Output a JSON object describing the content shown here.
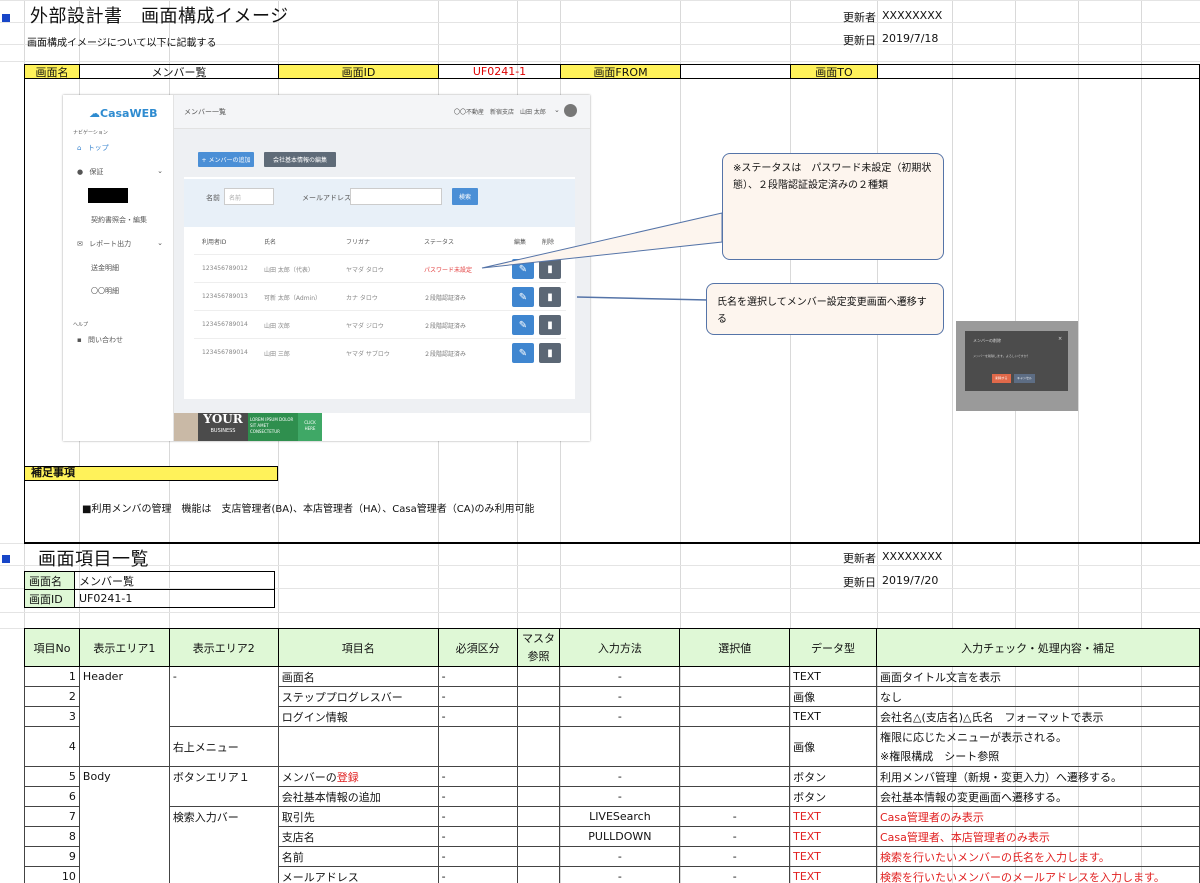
{
  "doc": {
    "title": "外部設計書　画面構成イメージ",
    "subtitle": "画面構成イメージについて以下に記載する",
    "updater_label": "更新者",
    "updater_value": "XXXXXXXX",
    "updated_label": "更新日",
    "updated_value": "2019/7/18"
  },
  "header_bar": {
    "screen_name_label": "画面名",
    "screen_name_value": "メンバー覧",
    "screen_id_label": "画面ID",
    "screen_id_value": "UF0241-1",
    "from_label": "画面FROM",
    "from_value": "",
    "to_label": "画面TO",
    "to_value": ""
  },
  "mock": {
    "logo": "CasaWEB",
    "nav_caption": "ナビゲーション",
    "nav_items": [
      "トップ",
      "保証",
      "",
      "契約書照会・編集",
      "レポート出力",
      "送金明細",
      "〇〇明細"
    ],
    "help_caption": "ヘルプ",
    "help_item": "問い合わせ",
    "page_title": "メンバー一覧",
    "user_info": "〇〇不動産　新宿支店　山田 太郎",
    "add_member_btn": "+ メンバーの追加",
    "edit_company_btn": "会社基本情報の編集",
    "name_label": "名前",
    "name_placeholder": "名前",
    "email_label": "メールアドレス",
    "search_btn": "検索",
    "columns": [
      "利用者ID",
      "氏名",
      "フリガナ",
      "ステータス",
      "編集",
      "削除"
    ],
    "rows": [
      {
        "id": "123456789012",
        "name": "山田 太郎（代表）",
        "kana": "ヤマダ タロウ",
        "status": "パスワード未設定",
        "status_color": "#e23b3b"
      },
      {
        "id": "123456789013",
        "name": "可新 太郎（Admin）",
        "kana": "カナ タロウ",
        "status": "２段階認証済み",
        "status_color": "#777777"
      },
      {
        "id": "123456789014",
        "name": "山田 次郎",
        "kana": "ヤマダ ジロウ",
        "status": "２段階認証済み",
        "status_color": "#777777"
      },
      {
        "id": "123456789014",
        "name": "山田 三郎",
        "kana": "ヤマダ サブロウ",
        "status": "２段階認証済み",
        "status_color": "#777777"
      }
    ],
    "banner_big": "YOUR",
    "banner_small": "BUSINESS",
    "banner_lorem": "LOREM IPSUM DOLOR SIT AMET CONSECTETUR",
    "banner_click": "CLICK HERE"
  },
  "callouts": {
    "status_note": "※ステータスは　パスワード未設定（初期状態）、２段階認証設定済みの２種類",
    "name_note": "氏名を選択してメンバー設定変更画面へ遷移する"
  },
  "popup": {
    "title": "メンバーの削除",
    "body": "メンバーを削除します。よろしいですか？",
    "delete_btn": "削除する",
    "cancel_btn": "キャンセル"
  },
  "supplement": {
    "label": "補足事項",
    "note": "■利用メンバの管理　機能は　支店管理者(BA)、本店管理者（HA）、Casa管理者（CA)のみ利用可能"
  },
  "item_list": {
    "title": "画面項目一覧",
    "updater_label": "更新者",
    "updater_value": "XXXXXXXX",
    "updated_label": "更新日",
    "updated_value": "2019/7/20",
    "screen_name_label": "画面名",
    "screen_name_value": "メンバー覧",
    "screen_id_label": "画面ID",
    "screen_id_value": "UF0241-1"
  },
  "table": {
    "headers": [
      "項目No",
      "表示エリア1",
      "表示エリア2",
      "項目名",
      "必須区分",
      "マスタ参照",
      "入力方法",
      "選択値",
      "データ型",
      "入力チェック・処理内容・補足"
    ],
    "rows": [
      {
        "no": "1",
        "a1": "Header",
        "a2": "-",
        "name": "画面名",
        "req": "-",
        "input": "-",
        "sel": "",
        "type": "TEXT",
        "note": "画面タイトル文言を表示"
      },
      {
        "no": "2",
        "a1": "",
        "a2": "",
        "name": "ステッププログレスバー",
        "req": "-",
        "input": "-",
        "sel": "",
        "type": "画像",
        "note": "なし"
      },
      {
        "no": "3",
        "a1": "",
        "a2": "",
        "name": "ログイン情報",
        "req": "-",
        "input": "-",
        "sel": "",
        "type": "TEXT",
        "note": "会社名△(支店名)△氏名　フォーマットで表示"
      },
      {
        "no": "4",
        "a1": "",
        "a2": "右上メニュー",
        "name": "",
        "req": "",
        "input": "",
        "sel": "",
        "type": "画像",
        "note": "権限に応じたメニューが表示される。",
        "note2": "※権限構成　シート参照"
      },
      {
        "no": "5",
        "a1": "Body",
        "a2": "ボタンエリア１",
        "name": "メンバーの",
        "name_red": "登録",
        "req": "-",
        "input": "-",
        "sel": "",
        "type": "ボタン",
        "note": "利用メンバ管理（新規・変更入力）へ遷移する。"
      },
      {
        "no": "6",
        "a1": "",
        "a2": "",
        "name": "会社基本情報の追加",
        "req": "-",
        "input": "-",
        "sel": "",
        "type": "ボタン",
        "note": "会社基本情報の変更画面へ遷移する。"
      },
      {
        "no": "7",
        "a1": "",
        "a2": "検索入力バー",
        "name": "取引先",
        "req": "-",
        "input": "LIVESearch",
        "sel": "-",
        "type": "TEXT",
        "note": "Casa管理者のみ表示",
        "red": true
      },
      {
        "no": "8",
        "a1": "",
        "a2": "",
        "name": "支店名",
        "req": "-",
        "input": "PULLDOWN",
        "sel": "-",
        "type": "TEXT",
        "note": "Casa管理者、本店管理者のみ表示",
        "red": true
      },
      {
        "no": "9",
        "a1": "",
        "a2": "",
        "name": "名前",
        "req": "-",
        "input": "-",
        "sel": "-",
        "type": "TEXT",
        "note": "検索を行いたいメンバーの氏名を入力します。",
        "red": true
      },
      {
        "no": "10",
        "a1": "",
        "a2": "",
        "name": "メールアドレス",
        "req": "-",
        "input": "-",
        "sel": "-",
        "type": "TEXT",
        "note": "検索を行いたいメンバーのメールアドレスを入力します。",
        "red": true
      }
    ]
  }
}
